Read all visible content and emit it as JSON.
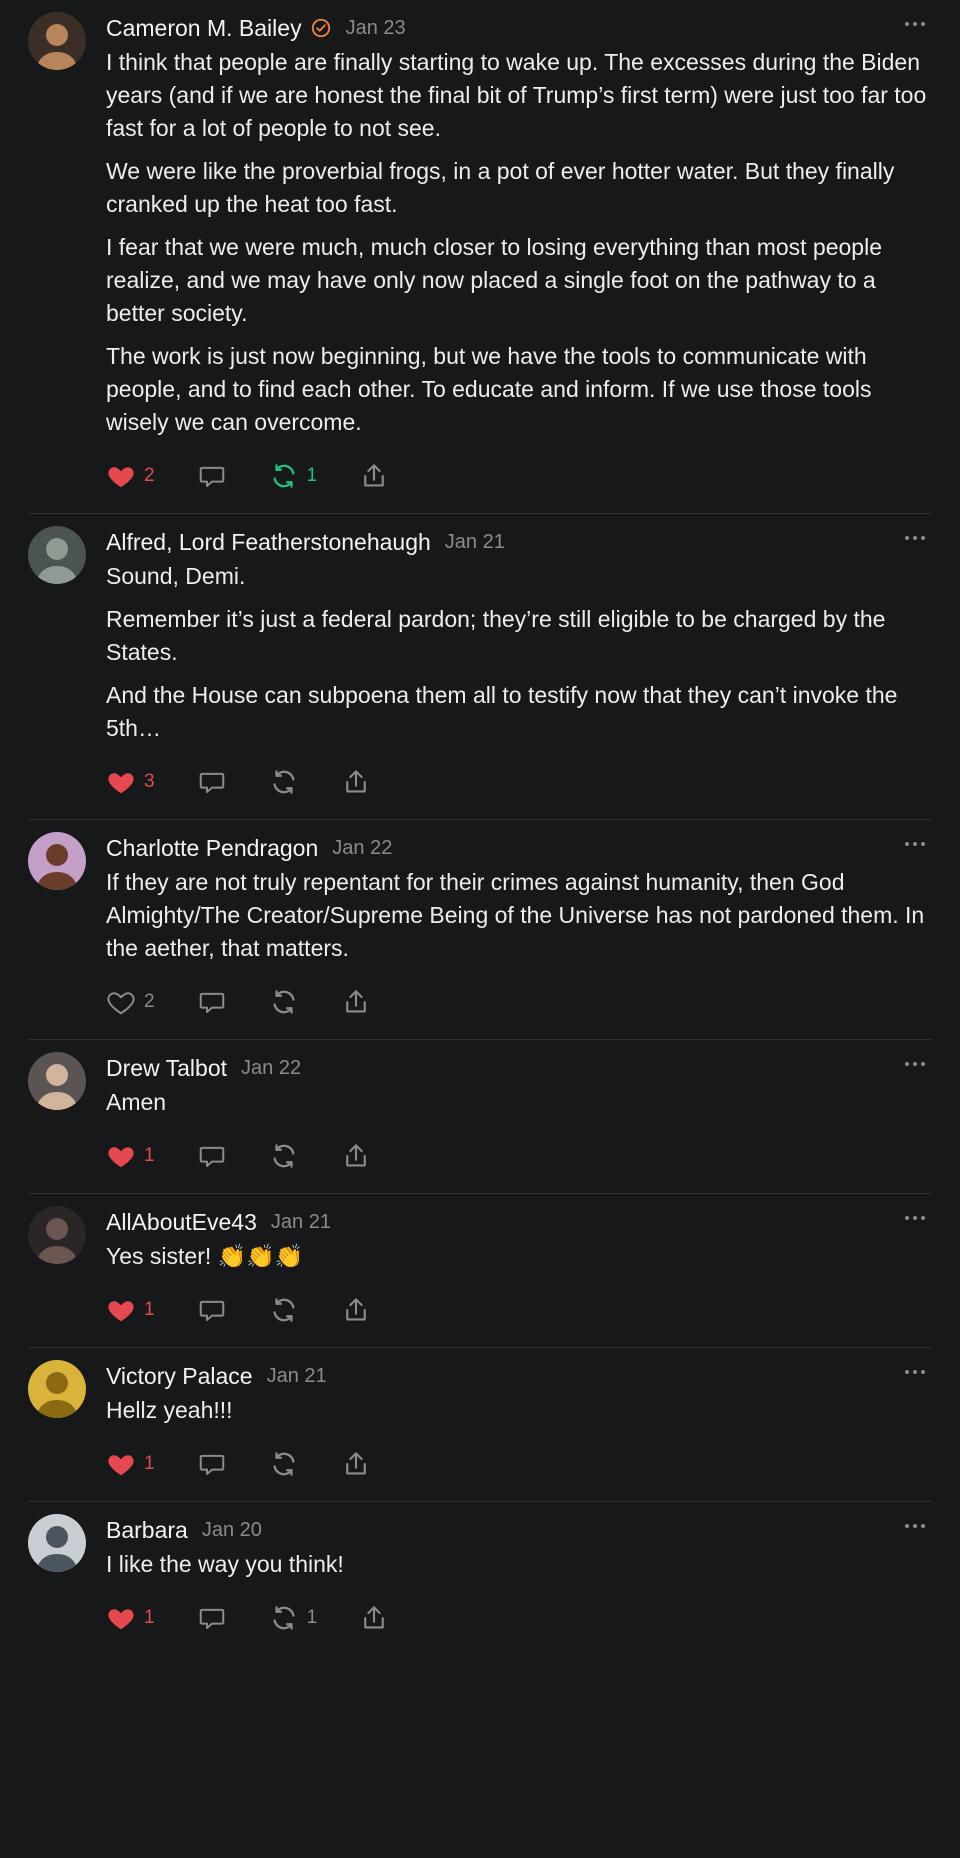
{
  "colors": {
    "background": "#17181a",
    "text": "#ececec",
    "muted": "#8a8b8f",
    "like": "#e5484d",
    "repost": "#21c27a",
    "verified": "#f0823c",
    "divider": "#2e2f32"
  },
  "posts": [
    {
      "author": "Cameron M. Bailey",
      "verified": true,
      "date": "Jan 23",
      "avatar": {
        "bg": "#3a2e26",
        "fg": "#b8845a"
      },
      "paragraphs": [
        "I think that people are finally starting to wake up. The excesses during the Biden years (and if we are honest the final bit of Trump’s first term) were just too far too fast for a lot of people to not see.",
        "We were like the proverbial frogs, in a pot of ever hotter water. But they finally cranked up the heat too fast.",
        "I fear that we were much, much closer to losing everything than most people realize, and we may have only now placed a single foot on the pathway to a better society.",
        "The work is just now beginning, but we have the tools to communicate with people, and to find each other. To educate and inform. If we use those tools wisely we can overcome."
      ],
      "likes": "2",
      "liked": true,
      "reposts": "1",
      "reposted": true
    },
    {
      "author": "Alfred, Lord Featherstonehaugh",
      "verified": false,
      "date": "Jan 21",
      "avatar": {
        "bg": "#4b5550",
        "fg": "#8e9a92"
      },
      "paragraphs": [
        "Sound, Demi.",
        "Remember it’s just a federal pardon; they’re still eligible to be charged by the States.",
        "And the House can subpoena them all to testify now that they can’t invoke the 5th…"
      ],
      "likes": "3",
      "liked": true,
      "reposts": "",
      "reposted": false
    },
    {
      "author": "Charlotte Pendragon",
      "verified": false,
      "date": "Jan 22",
      "avatar": {
        "bg": "#c4a0c8",
        "fg": "#6a3d2a"
      },
      "paragraphs": [
        "If they are not truly repentant for their crimes against humanity, then God Almighty/The Creator/Supreme Being of the Universe has not pardoned them. In the aether, that matters."
      ],
      "likes": "2",
      "liked": false,
      "reposts": "",
      "reposted": false
    },
    {
      "author": "Drew Talbot",
      "verified": false,
      "date": "Jan 22",
      "avatar": {
        "bg": "#5a5552",
        "fg": "#d2b49c"
      },
      "paragraphs": [
        "Amen"
      ],
      "likes": "1",
      "liked": true,
      "reposts": "",
      "reposted": false
    },
    {
      "author": "AllAboutEve43",
      "verified": false,
      "date": "Jan 21",
      "avatar": {
        "bg": "#2a2626",
        "fg": "#6b5550"
      },
      "paragraphs": [
        "Yes sister! 👏👏👏"
      ],
      "likes": "1",
      "liked": true,
      "reposts": "",
      "reposted": false
    },
    {
      "author": "Victory Palace",
      "verified": false,
      "date": "Jan 21",
      "avatar": {
        "bg": "#d9b33a",
        "fg": "#8a6a12"
      },
      "paragraphs": [
        "Hellz yeah!!!"
      ],
      "likes": "1",
      "liked": true,
      "reposts": "",
      "reposted": false
    },
    {
      "author": "Barbara",
      "verified": false,
      "date": "Jan 20",
      "avatar": {
        "bg": "#c9ced2",
        "fg": "#4a5560"
      },
      "paragraphs": [
        "I like the way you think!"
      ],
      "likes": "1",
      "liked": true,
      "reposts": "1",
      "reposted": false
    }
  ]
}
